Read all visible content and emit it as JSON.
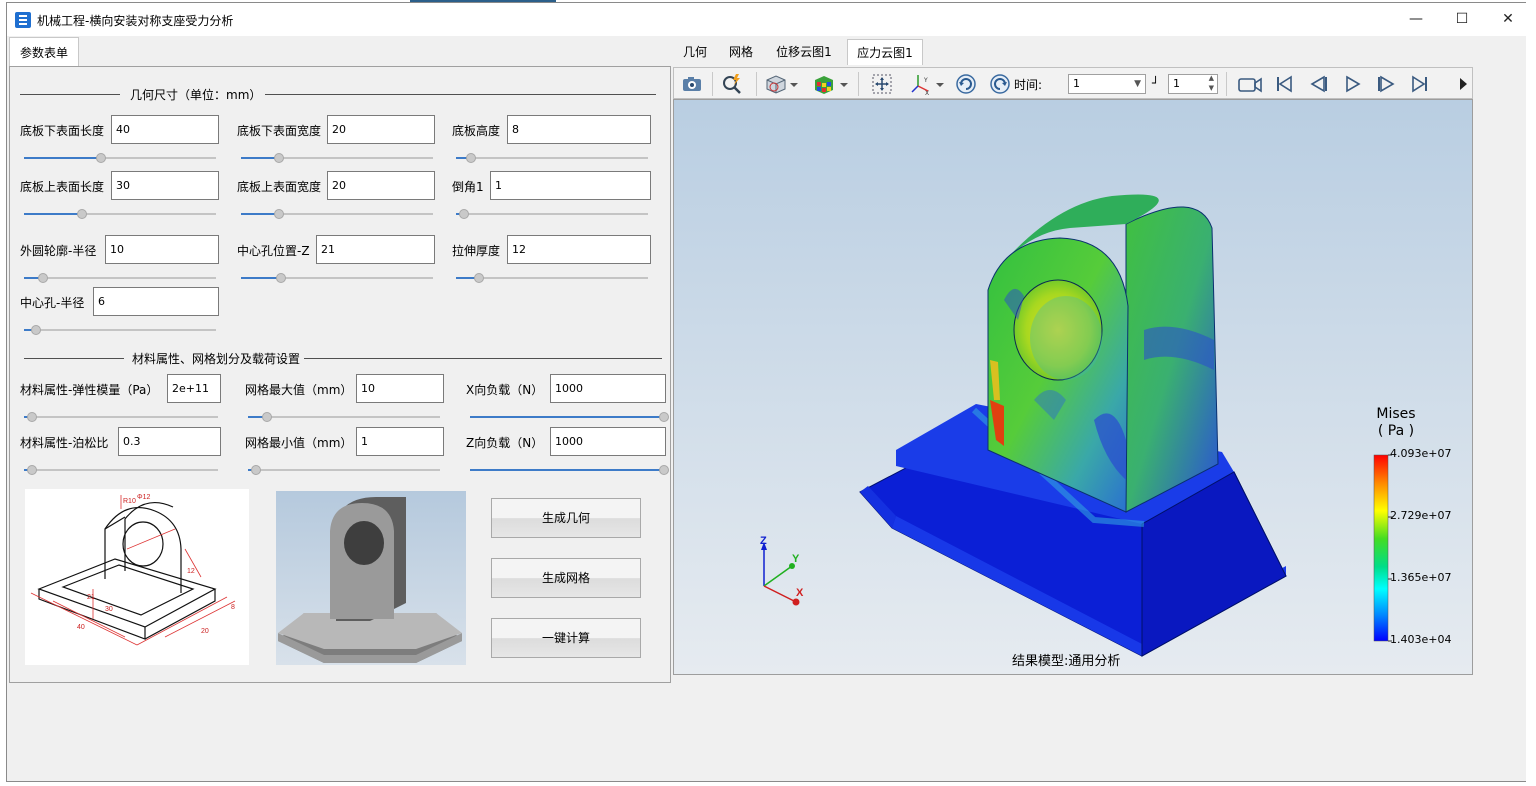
{
  "window": {
    "title": "机械工程-横向安装对称支座受力分析",
    "controls": {
      "minimize": "—",
      "maximize": "☐",
      "close": "✕"
    }
  },
  "left_tab": "参数表单",
  "geometry_section": {
    "title": "几何尺寸（单位：mm）",
    "fields": [
      {
        "label": "底板下表面长度",
        "value": "40",
        "slider": 0.4
      },
      {
        "label": "底板下表面宽度",
        "value": "20",
        "slider": 0.2
      },
      {
        "label": "底板高度",
        "value": "8",
        "slider": 0.08
      },
      {
        "label": "底板上表面长度",
        "value": "30",
        "slider": 0.3
      },
      {
        "label": "底板上表面宽度",
        "value": "20",
        "slider": 0.2
      },
      {
        "label": "倒角1",
        "value": "1",
        "slider": 0.0
      },
      {
        "label": "外圆轮廓-半径",
        "value": "10",
        "slider": 0.1
      },
      {
        "label": "中心孔位置-Z",
        "value": "21",
        "slider": 0.21
      },
      {
        "label": "拉伸厚度",
        "value": "12",
        "slider": 0.12
      },
      {
        "label": "中心孔-半径",
        "value": "6",
        "slider": 0.06
      }
    ]
  },
  "material_section": {
    "title": "材料属性、网格划分及载荷设置",
    "fields": [
      {
        "label": "材料属性-弹性模量（Pa）",
        "value": "2e+11",
        "slider": 0.0
      },
      {
        "label": "网格最大值（mm）",
        "value": "10",
        "slider": 0.1
      },
      {
        "label": "X向负载（N）",
        "value": "1000",
        "slider": 1.0
      },
      {
        "label": "材料属性-泊松比",
        "value": "0.3",
        "slider": 0.0
      },
      {
        "label": "网格最小值（mm）",
        "value": "1",
        "slider": 0.0
      },
      {
        "label": "Z向负载（N）",
        "value": "1000",
        "slider": 1.0
      }
    ]
  },
  "buttons": {
    "gen_geometry": "生成几何",
    "gen_mesh": "生成网格",
    "compute": "一键计算"
  },
  "drawing_dims": [
    "R10",
    "Φ12",
    "21",
    "12",
    "40",
    "30",
    "20",
    "8"
  ],
  "right_tabs": [
    "几何",
    "网格",
    "位移云图1",
    "应力云图1"
  ],
  "active_right_tab": 3,
  "toolbar": {
    "time_label": "时间:",
    "time_value": "1",
    "step_value": "1"
  },
  "legend": {
    "title_line1": "Mises",
    "title_line2": "( Pa )",
    "max": "4.093e+07",
    "v2": "2.729e+07",
    "v3": "1.365e+07",
    "min": "1.403e+04"
  },
  "axes": {
    "x": "X",
    "y": "Y",
    "z": "Z"
  },
  "result_label": "结果模型:通用分析",
  "colors": {
    "accent": "#3d7bc8",
    "fem_low": "#0018d0",
    "fem_high": "#e01010"
  }
}
